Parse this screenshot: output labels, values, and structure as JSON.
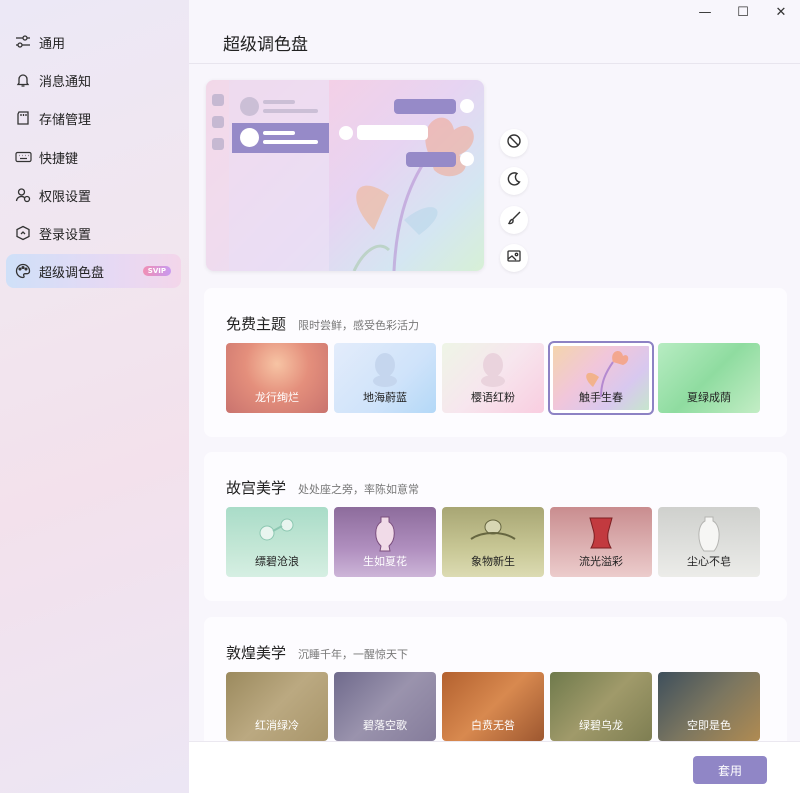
{
  "sidebar": {
    "items": [
      {
        "label": "通用",
        "icon": "sliders-icon"
      },
      {
        "label": "消息通知",
        "icon": "bell-icon"
      },
      {
        "label": "存储管理",
        "icon": "storage-icon"
      },
      {
        "label": "快捷键",
        "icon": "keyboard-icon"
      },
      {
        "label": "权限设置",
        "icon": "user-lock-icon"
      },
      {
        "label": "登录设置",
        "icon": "shield-icon"
      },
      {
        "label": "超级调色盘",
        "icon": "palette-icon",
        "badge": "SVIP",
        "active": true
      }
    ]
  },
  "window": {
    "minimize": "—",
    "maximize": "☐",
    "close": "✕"
  },
  "page": {
    "title": "超级调色盘"
  },
  "tools": [
    "ban-icon",
    "moon-icon",
    "brush-icon",
    "image-icon"
  ],
  "sections": [
    {
      "title": "免费主题",
      "subtitle": "限时尝鲜，感受色彩活力",
      "tiles": [
        {
          "label": "龙行绚烂"
        },
        {
          "label": "地海蔚蓝"
        },
        {
          "label": "樱语红粉"
        },
        {
          "label": "触手生春",
          "selected": true
        },
        {
          "label": "夏绿成荫"
        }
      ]
    },
    {
      "title": "故宫美学",
      "subtitle": "处处座之旁，率陈如意常",
      "tiles": [
        {
          "label": "缥碧沧浪"
        },
        {
          "label": "生如夏花"
        },
        {
          "label": "象物新生"
        },
        {
          "label": "流光溢彩"
        },
        {
          "label": "尘心不皂"
        }
      ]
    },
    {
      "title": "敦煌美学",
      "subtitle": "沉睡千年，一醒惊天下",
      "tiles": [
        {
          "label": "红消绿冷"
        },
        {
          "label": "碧落空歌"
        },
        {
          "label": "白贲无咎"
        },
        {
          "label": "绿碧乌龙"
        },
        {
          "label": "空即是色"
        }
      ]
    }
  ],
  "footer": {
    "apply_label": "套用"
  },
  "colors": {
    "accent": "#9086c6",
    "selected_border": "#8d82c4"
  }
}
